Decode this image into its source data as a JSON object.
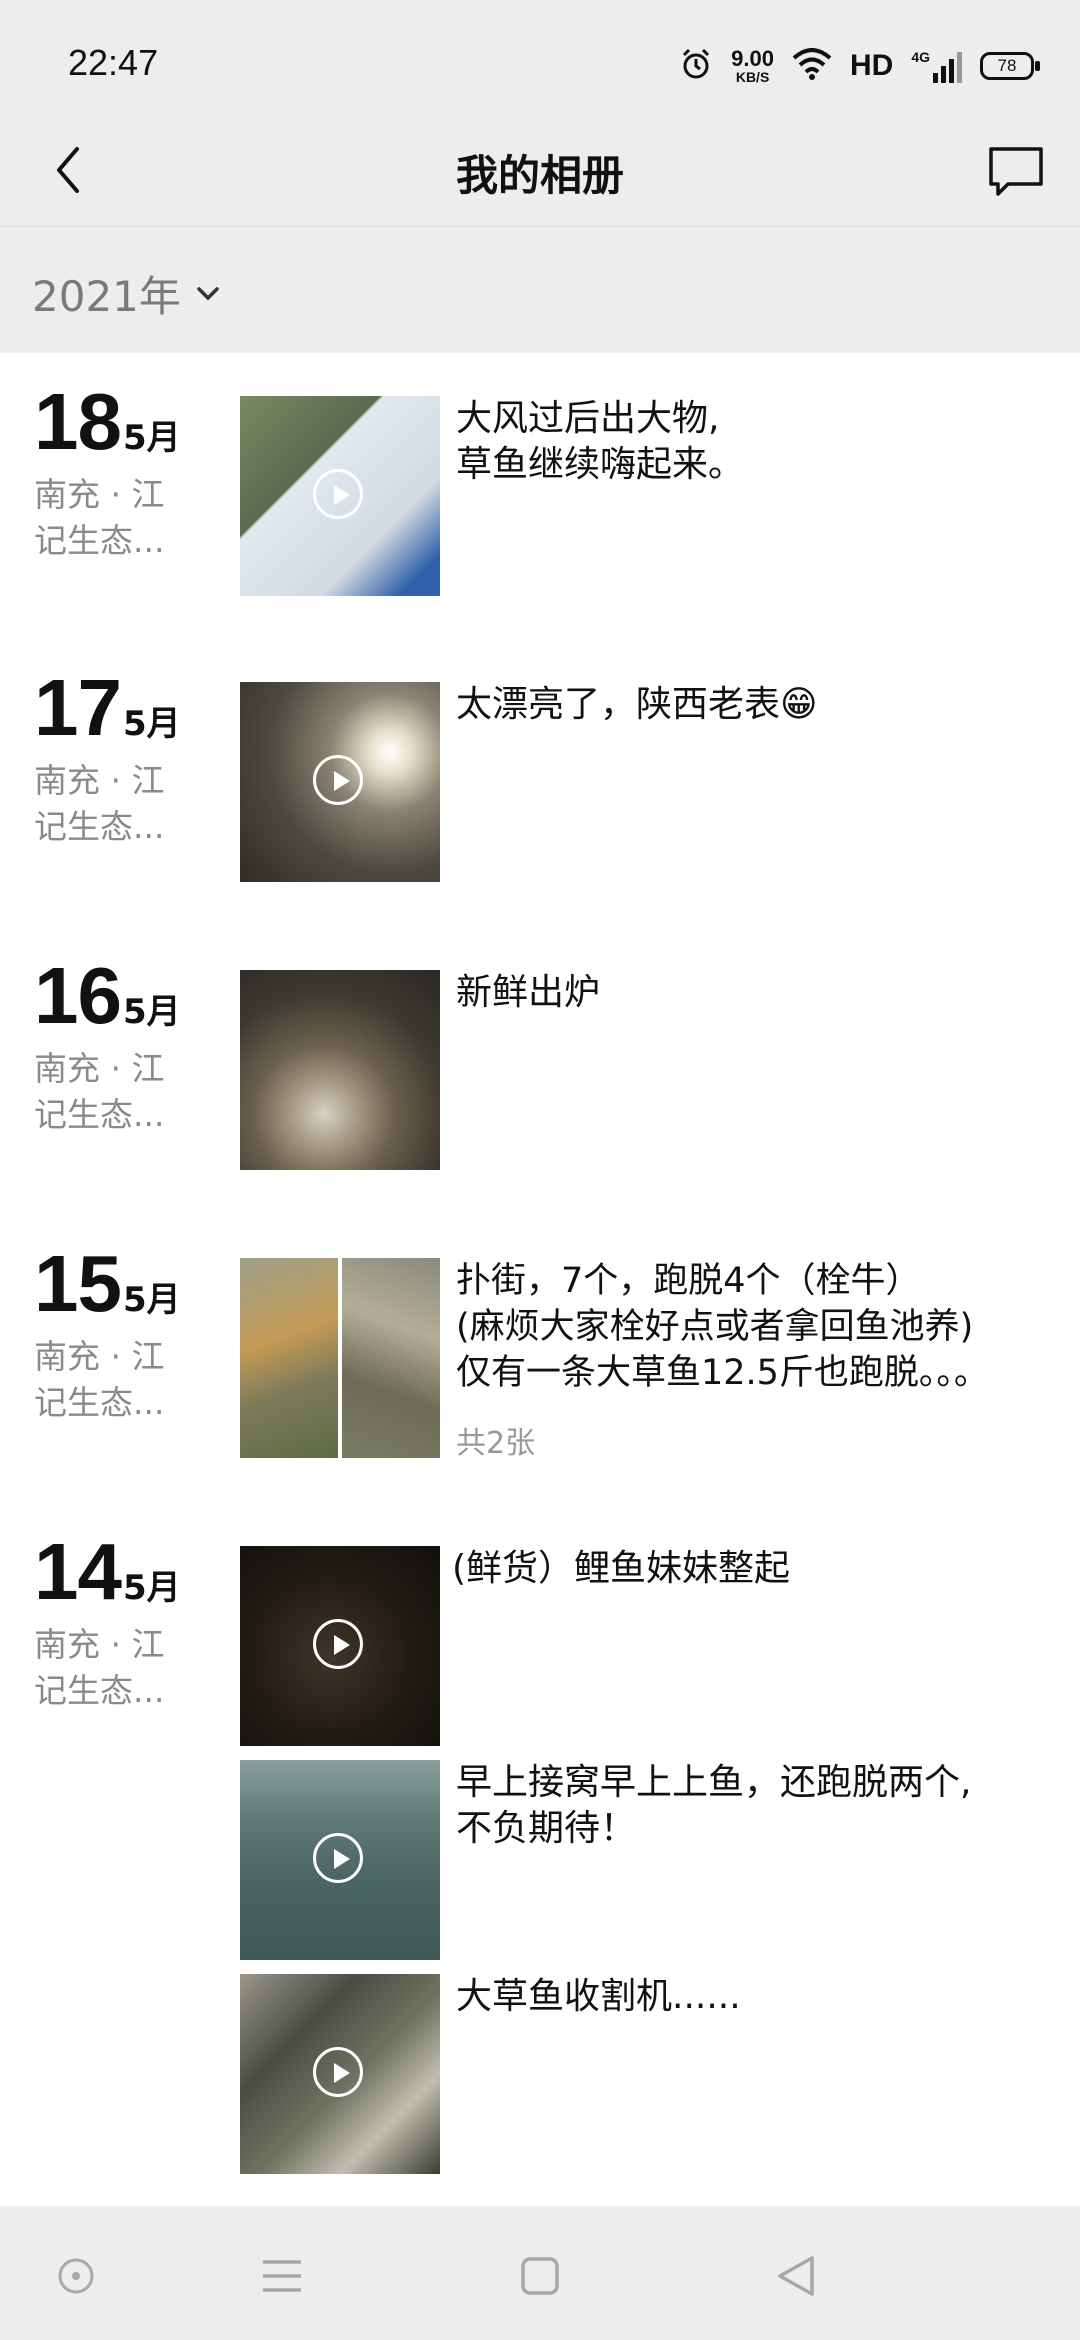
{
  "status_bar": {
    "time": "22:47",
    "speed_value": "9.00",
    "speed_unit": "KB/S",
    "hd": "HD",
    "network": "4G",
    "battery": "78",
    "icons": [
      "alarm-icon",
      "wifi-icon",
      "signal-icon",
      "battery-icon"
    ]
  },
  "header": {
    "title": "我的相册",
    "back_icon": "back-arrow-icon",
    "message_icon": "message-icon"
  },
  "year_selector": {
    "label": "2021年",
    "icon": "chevron-down-icon"
  },
  "entries": [
    {
      "day": "18",
      "month": "5月",
      "location": "南充 · 江记生态...",
      "posts": [
        {
          "caption": "大风过后出大物,\n草鱼继续嗨起来。",
          "media": "video",
          "thumb_colors": [
            "#6b7a5a",
            "#dfe6ec"
          ]
        }
      ]
    },
    {
      "day": "17",
      "month": "5月",
      "location": "南充 · 江记生态...",
      "posts": [
        {
          "caption": "太漂亮了，陕西老表😁",
          "media": "video",
          "thumb_colors": [
            "#5c5a4f",
            "#b9b2a2"
          ]
        }
      ]
    },
    {
      "day": "16",
      "month": "5月",
      "location": "南充 · 江记生态...",
      "posts": [
        {
          "caption": "新鲜出炉",
          "media": "image",
          "thumb_colors": [
            "#3c3a33",
            "#9e8f76"
          ]
        }
      ]
    },
    {
      "day": "15",
      "month": "5月",
      "location": "南充 · 江记生态...",
      "posts": [
        {
          "caption": "扑街，7个，跑脱4个（栓牛）\n(麻烦大家栓好点或者拿回鱼池养)\n仅有一条大草鱼12.5斤也跑脱。。。",
          "media": "images",
          "count": "共2张",
          "thumb_colors": [
            "#7f8060",
            "#8c8b78"
          ]
        }
      ]
    },
    {
      "day": "14",
      "month": "5月",
      "location": "南充 · 江记生态...",
      "posts": [
        {
          "caption": "(鲜货）鲤鱼妹妹整起",
          "media": "video",
          "thumb_colors": [
            "#1a1612",
            "#3a3128"
          ]
        },
        {
          "caption": "早上接窝早上上鱼，还跑脱两个,\n不负期待！",
          "media": "video",
          "thumb_colors": [
            "#4e6a66",
            "#6f8884"
          ]
        },
        {
          "caption": "大草鱼收割机......",
          "media": "video",
          "thumb_colors": [
            "#4a4c42",
            "#a29f93"
          ]
        }
      ]
    }
  ],
  "nav_bar": {
    "icons": [
      "assistant-icon",
      "menu-icon",
      "home-icon",
      "back-icon"
    ]
  }
}
